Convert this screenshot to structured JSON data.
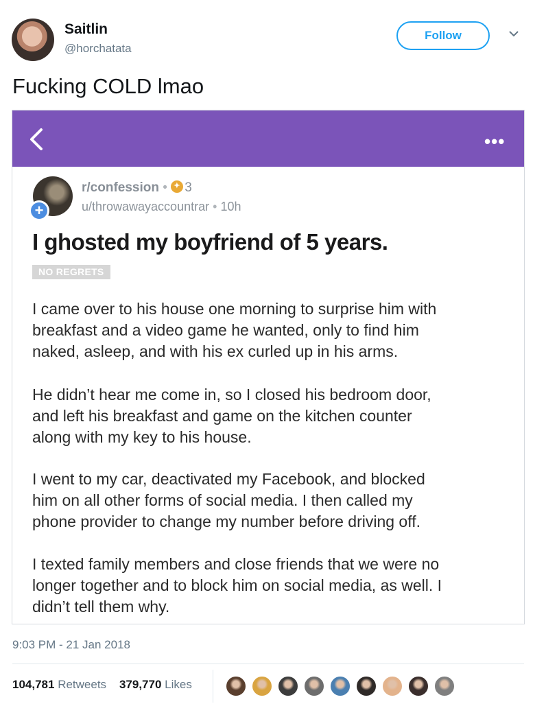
{
  "tweet": {
    "display_name": "Saitlin",
    "handle": "@horchatata",
    "follow_label": "Follow",
    "text": "Fucking COLD lmao",
    "timestamp": "9:03 PM - 21 Jan 2018",
    "retweets_count": "104,781",
    "retweets_label": "Retweets",
    "likes_count": "379,770",
    "likes_label": "Likes",
    "liker_avatars": [
      "#5a3f2e",
      "#d9a441",
      "#3c3c3c",
      "#6d6d6d",
      "#4a7fb0",
      "#2f2a28",
      "#e3b38c",
      "#3a2e2c",
      "#7f7f7f"
    ]
  },
  "reddit_post": {
    "more_label": "•••",
    "subreddit": "r/confession",
    "separator": "•",
    "awards": "3",
    "author": "u/throwawayaccountrar",
    "age": "10h",
    "plus_label": "+",
    "title": "I ghosted my boyfriend of 5 years.",
    "flair": "NO REGRETS",
    "paragraphs": [
      "I came over to his house one morning to surprise him with\nbreakfast and a video game he wanted, only to find him\nnaked, asleep, and  with his ex curled up in his arms.",
      "He didn’t hear me come in, so I closed his bedroom door,\nand left his breakfast and game on the kitchen counter\nalong with my key to his house.",
      "I went to my car, deactivated my Facebook, and blocked\nhim on all other forms of social media. I then called my\nphone provider to change my number before driving off.",
      "I texted family members and close friends that we were no\nlonger together and to block him on social media, as well. I\ndidn’t tell them why."
    ],
    "colors": {
      "header": "#7b54b9",
      "plus": "#4c8de0",
      "award": "#e9a935"
    }
  },
  "colors": {
    "accent": "#1da1f2",
    "secondary_text": "#657786"
  }
}
